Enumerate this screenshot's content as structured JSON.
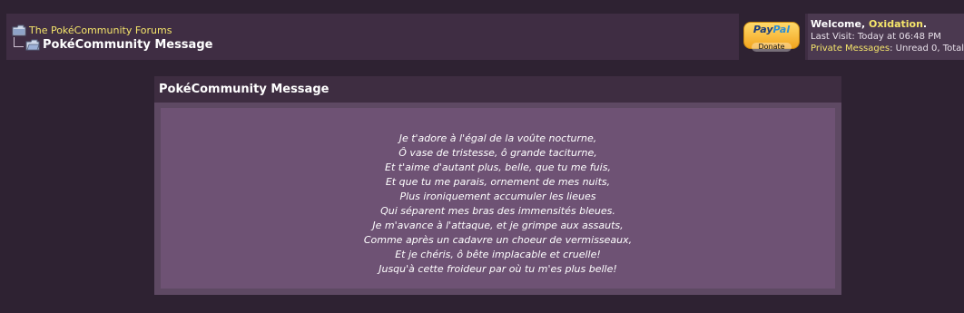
{
  "breadcrumb": {
    "parent": "The PokéCommunity Forums",
    "current": "PokéCommunity Message"
  },
  "paypal": {
    "logo_pay": "Pay",
    "logo_pal": "Pal",
    "donate": "Donate"
  },
  "welcome": {
    "greeting": "Welcome, ",
    "username": "Oxidation",
    "greeting_end": ".",
    "last_visit_label": "Last Visit: ",
    "last_visit_value": "Today at 06:48 PM",
    "pm_label": "Private Messages",
    "pm_value": ": Unread 0, Total"
  },
  "message": {
    "title": "PokéCommunity Message",
    "poem": [
      "Je t'adore à l'égal de la voûte nocturne,",
      "Ô vase de tristesse, ô grande taciturne,",
      "Et t'aime d'autant plus, belle, que tu me fuis,",
      "Et que tu me parais, ornement de mes nuits,",
      "Plus ironiquement accumuler les lieues",
      "Qui séparent mes bras des immensités bleues.",
      "Je m'avance à l'attaque, et je grimpe aux assauts,",
      "Comme après un cadavre un choeur de vermisseaux,",
      "Et je chéris, ô bête implacable et cruelle!",
      "Jusqu'à cette froideur par où tu m'es plus belle!"
    ]
  },
  "colors": {
    "background": "#2e2232",
    "link": "#f5e56b",
    "panel": "#3e2d41",
    "message_bg": "#6e5274"
  },
  "icons": {
    "breadcrumb": "folder-icon"
  }
}
